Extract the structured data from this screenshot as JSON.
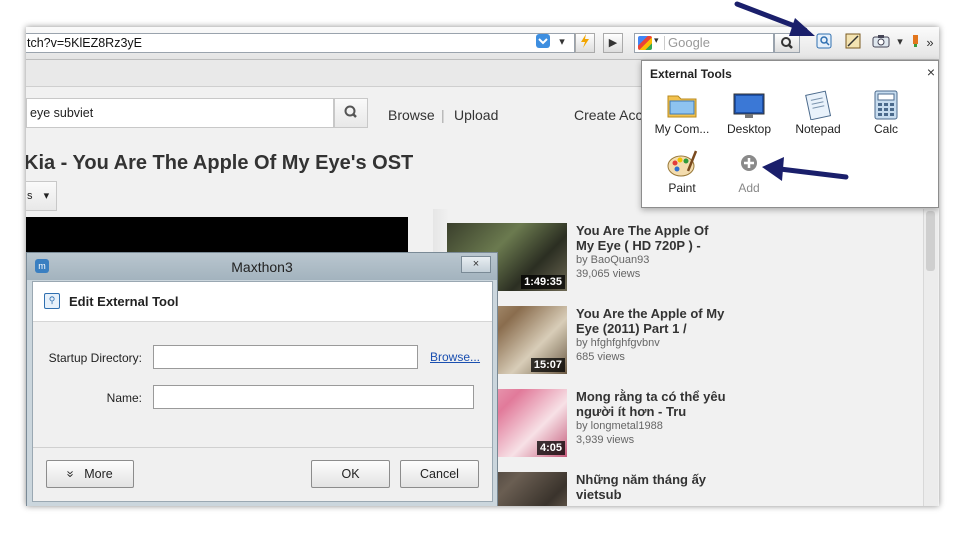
{
  "toolbar": {
    "address": "tch?v=5KlEZ8Rz3yE",
    "search_placeholder": "Google",
    "overflow": "»"
  },
  "page": {
    "search_value": "eye subviet",
    "nav": [
      "Browse",
      "Upload",
      "Create Acc"
    ],
    "nav_separator": "|",
    "video_title": "Kia - You Are The Apple Of My Eye's OST",
    "dropdown_label": "s",
    "related": [
      {
        "title": "You Are The Apple Of My Eye ( HD 720P ) -",
        "by": "by BaoQuan93",
        "views": "39,065 views",
        "duration": "1:49:35"
      },
      {
        "title": "You Are the Apple of My Eye (2011) Part 1 /",
        "by": "by hfghfghfgvbnv",
        "views": "685 views",
        "duration": "15:07"
      },
      {
        "title": "Mong rằng ta có thể yêu người ít hơn - Tru",
        "by": "by longmetal1988",
        "views": "3,939 views",
        "duration": "4:05"
      },
      {
        "title": "Những năm tháng ấy vietsub",
        "by": "",
        "views": "",
        "duration": ""
      }
    ]
  },
  "external_tools": {
    "title": "External Tools",
    "close": "×",
    "tools": [
      {
        "label": "My Com...",
        "icon": "folder-icon"
      },
      {
        "label": "Desktop",
        "icon": "desktop-icon"
      },
      {
        "label": "Notepad",
        "icon": "notepad-icon"
      },
      {
        "label": "Calc",
        "icon": "calc-icon"
      },
      {
        "label": "Paint",
        "icon": "paint-icon"
      },
      {
        "label": "Add",
        "icon": "add-icon"
      }
    ]
  },
  "dialog": {
    "window_title": "Maxthon3",
    "close": "×",
    "header": "Edit External Tool",
    "startup_label": "Startup Directory:",
    "startup_value": "",
    "browse": "Browse...",
    "name_label": "Name:",
    "name_value": "",
    "more": "More",
    "more_glyph": "»",
    "ok": "OK",
    "cancel": "Cancel"
  },
  "colors": {
    "annotation_arrow": "#1a1f6b",
    "link": "#1a4fb0"
  }
}
